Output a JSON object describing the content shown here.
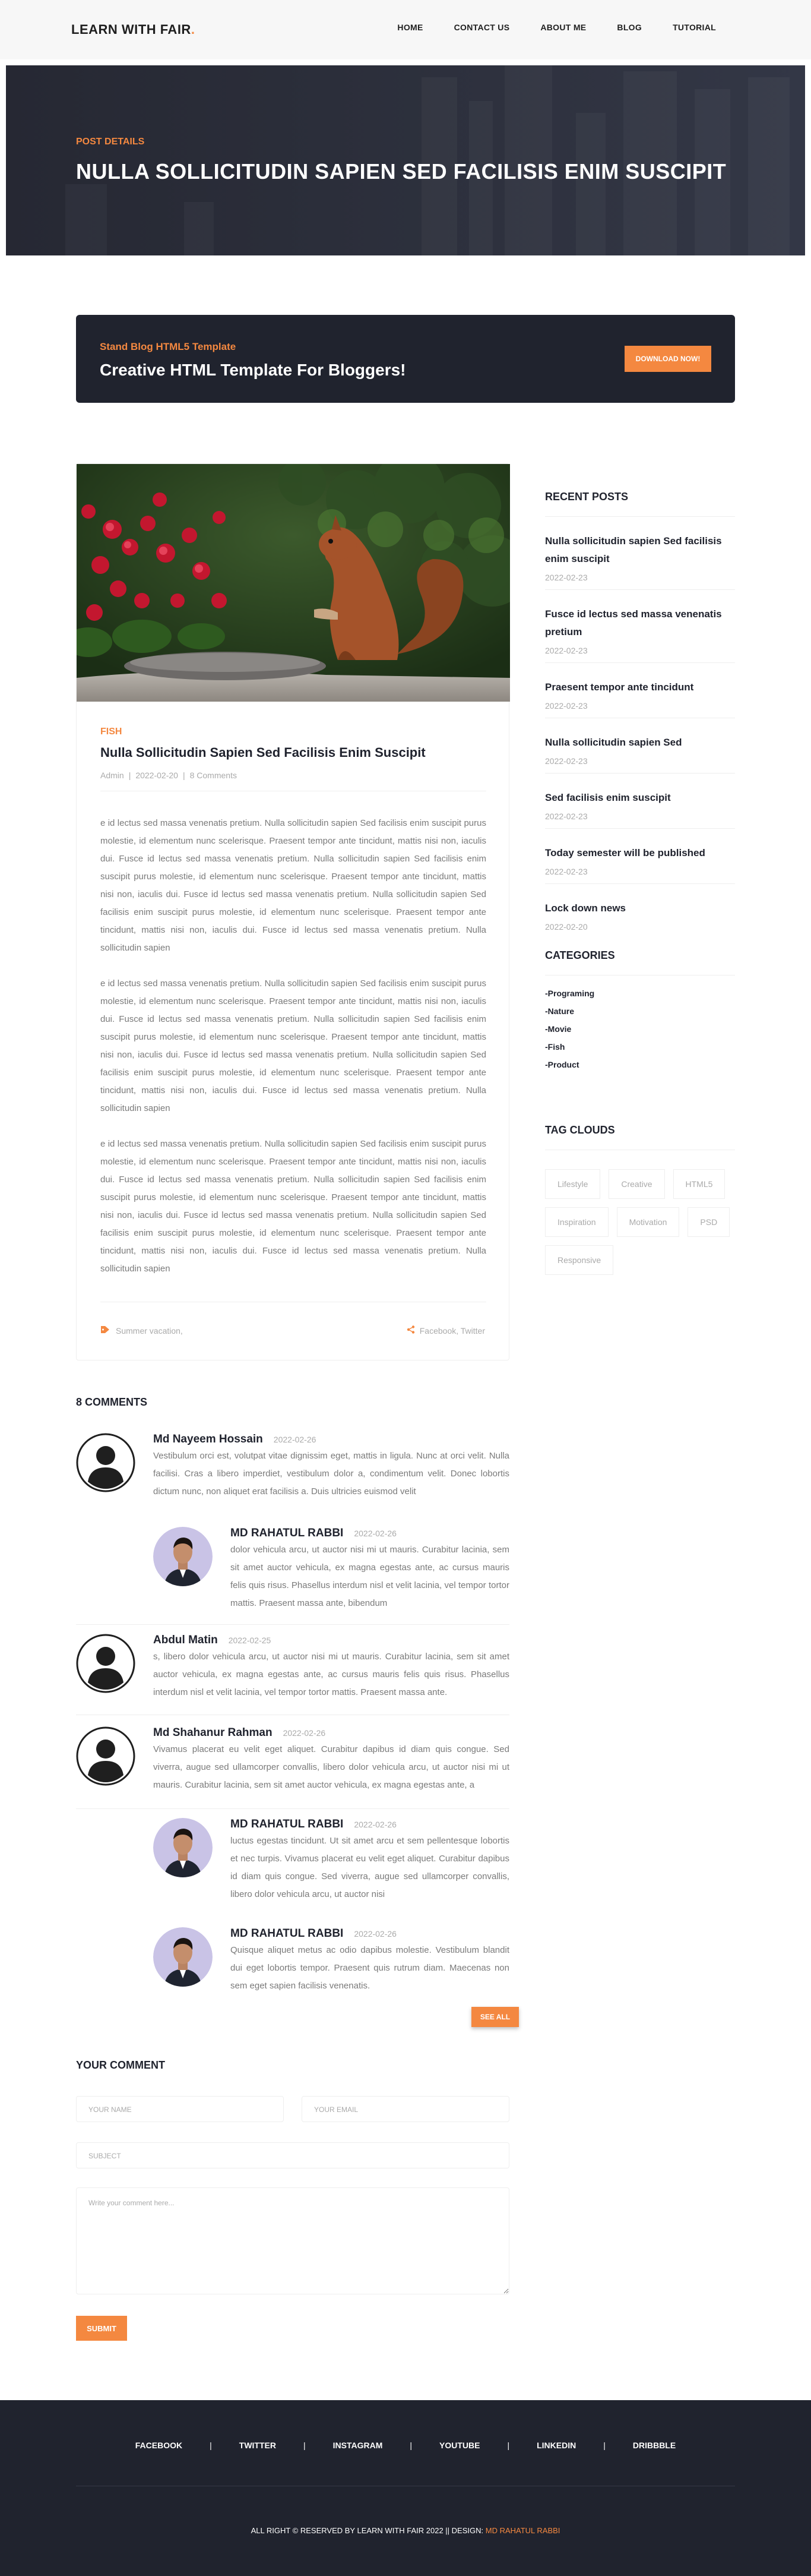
{
  "header": {
    "logo": "LEARN WITH FAIR",
    "logo_dot": ".",
    "nav": [
      "HOME",
      "CONTACT US",
      "ABOUT ME",
      "BLOG",
      "TUTORIAL"
    ]
  },
  "hero": {
    "small": "POST DETAILS",
    "title": "NULLA SOLLICITUDIN SAPIEN SED FACILISIS ENIM SUSCIPIT"
  },
  "cta": {
    "small": "Stand Blog HTML5 Template",
    "title": "Creative HTML Template For Bloggers!",
    "button": "DOWNLOAD NOW!"
  },
  "post": {
    "category": "FISH",
    "title": "Nulla Sollicitudin Sapien Sed Facilisis Enim Suscipit",
    "meta": [
      "Admin",
      "2022-02-20",
      "8 Comments"
    ],
    "paragraphs": [
      "e id lectus sed massa venenatis pretium. Nulla sollicitudin sapien Sed facilisis enim suscipit purus molestie, id elementum nunc scelerisque. Praesent tempor ante tincidunt, mattis nisi non, iaculis dui. Fusce id lectus sed massa venenatis pretium. Nulla sollicitudin sapien Sed facilisis enim suscipit purus molestie, id elementum nunc scelerisque. Praesent tempor ante tincidunt, mattis nisi non, iaculis dui. Fusce id lectus sed massa venenatis pretium. Nulla sollicitudin sapien Sed facilisis enim suscipit purus molestie, id elementum nunc scelerisque. Praesent tempor ante tincidunt, mattis nisi non, iaculis dui. Fusce id lectus sed massa venenatis pretium. Nulla sollicitudin sapien",
      "e id lectus sed massa venenatis pretium. Nulla sollicitudin sapien Sed facilisis enim suscipit purus molestie, id elementum nunc scelerisque. Praesent tempor ante tincidunt, mattis nisi non, iaculis dui. Fusce id lectus sed massa venenatis pretium. Nulla sollicitudin sapien Sed facilisis enim suscipit purus molestie, id elementum nunc scelerisque. Praesent tempor ante tincidunt, mattis nisi non, iaculis dui. Fusce id lectus sed massa venenatis pretium. Nulla sollicitudin sapien Sed facilisis enim suscipit purus molestie, id elementum nunc scelerisque. Praesent tempor ante tincidunt, mattis nisi non, iaculis dui. Fusce id lectus sed massa venenatis pretium. Nulla sollicitudin sapien",
      "e id lectus sed massa venenatis pretium. Nulla sollicitudin sapien Sed facilisis enim suscipit purus molestie, id elementum nunc scelerisque. Praesent tempor ante tincidunt, mattis nisi non, iaculis dui. Fusce id lectus sed massa venenatis pretium. Nulla sollicitudin sapien Sed facilisis enim suscipit purus molestie, id elementum nunc scelerisque. Praesent tempor ante tincidunt, mattis nisi non, iaculis dui. Fusce id lectus sed massa venenatis pretium. Nulla sollicitudin sapien Sed facilisis enim suscipit purus molestie, id elementum nunc scelerisque. Praesent tempor ante tincidunt, mattis nisi non, iaculis dui. Fusce id lectus sed massa venenatis pretium. Nulla sollicitudin sapien"
    ],
    "tags": "Summer vacation,",
    "share": "Facebook, Twitter"
  },
  "sidebar": {
    "recent_heading": "RECENT POSTS",
    "recent": [
      {
        "title": "Nulla sollicitudin sapien Sed facilisis enim suscipit",
        "date": "2022-02-23"
      },
      {
        "title": "Fusce id lectus sed massa venenatis pretium",
        "date": "2022-02-23"
      },
      {
        "title": "Praesent tempor ante tincidunt",
        "date": "2022-02-23"
      },
      {
        "title": "Nulla sollicitudin sapien Sed",
        "date": "2022-02-23"
      },
      {
        "title": "Sed facilisis enim suscipit",
        "date": "2022-02-23"
      },
      {
        "title": "Today semester will be published",
        "date": "2022-02-23"
      },
      {
        "title": "Lock down news",
        "date": "2022-02-20"
      }
    ],
    "categories_heading": "CATEGORIES",
    "categories": [
      "-Programing",
      "-Nature",
      "-Movie",
      "-Fish",
      "-Product"
    ],
    "tags_heading": "TAG CLOUDS",
    "tags": [
      "Lifestyle",
      "Creative",
      "HTML5",
      "Inspiration",
      "Motivation",
      "PSD",
      "Responsive"
    ]
  },
  "comments": {
    "heading": "8 COMMENTS",
    "items": [
      {
        "name": "Md Nayeem Hossain",
        "date": "2022-02-26",
        "text": "Vestibulum orci est, volutpat vitae dignissim eget, mattis in ligula. Nunc at orci velit. Nulla facilisi. Cras a libero imperdiet, vestibulum dolor a, condimentum velit. Donec lobortis dictum nunc, non aliquet erat facilisis a. Duis ultricies euismod velit"
      },
      {
        "name": "MD RAHATUL RABBI",
        "date": "2022-02-26",
        "text": "dolor vehicula arcu, ut auctor nisi mi ut mauris. Curabitur lacinia, sem sit amet auctor vehicula, ex magna egestas ante, ac cursus mauris felis quis risus. Phasellus interdum nisl et velit lacinia, vel tempor tortor mattis. Praesent massa ante, bibendum"
      },
      {
        "name": "Abdul Matin",
        "date": "2022-02-25",
        "text": "s, libero dolor vehicula arcu, ut auctor nisi mi ut mauris. Curabitur lacinia, sem sit amet auctor vehicula, ex magna egestas ante, ac cursus mauris felis quis risus. Phasellus interdum nisl et velit lacinia, vel tempor tortor mattis. Praesent massa ante."
      },
      {
        "name": "Md Shahanur Rahman",
        "date": "2022-02-26",
        "text": "Vivamus placerat eu velit eget aliquet. Curabitur dapibus id diam quis congue. Sed viverra, augue sed ullamcorper convallis, libero dolor vehicula arcu, ut auctor nisi mi ut mauris. Curabitur lacinia, sem sit amet auctor vehicula, ex magna egestas ante, a"
      },
      {
        "name": "MD RAHATUL RABBI",
        "date": "2022-02-26",
        "text": "luctus egestas tincidunt. Ut sit amet arcu et sem pellentesque lobortis et nec turpis. Vivamus placerat eu velit eget aliquet. Curabitur dapibus id diam quis congue. Sed viverra, augue sed ullamcorper convallis, libero dolor vehicula arcu, ut auctor nisi"
      },
      {
        "name": "MD RAHATUL RABBI",
        "date": "2022-02-26",
        "text": "Quisque aliquet metus ac odio dapibus molestie. Vestibulum blandit dui eget lobortis tempor. Praesent quis rutrum diam. Maecenas non sem eget sapien facilisis venenatis."
      }
    ],
    "see_all": "SEE ALL"
  },
  "comment_form": {
    "heading": "YOUR COMMENT",
    "name_placeholder": "YOUR NAME",
    "email_placeholder": "YOUR EMAIL",
    "subject_placeholder": "SUBJECT",
    "message_placeholder": "Write your comment here...",
    "submit": "SUBMIT"
  },
  "footer": {
    "social": [
      "FACEBOOK",
      "TWITTER",
      "INSTAGRAM",
      "YOUTUBE",
      "LINKEDIN",
      "DRIBBBLE"
    ],
    "separator": "|",
    "copyright": "ALL RIGHT © RESERVED BY LEARN WITH FAIR 2022 || DESIGN:",
    "designer": "MD RAHATUL RABBI"
  },
  "colors": {
    "accent": "#f48840",
    "dark": "#20232e",
    "muted": "#aaaaaa"
  }
}
